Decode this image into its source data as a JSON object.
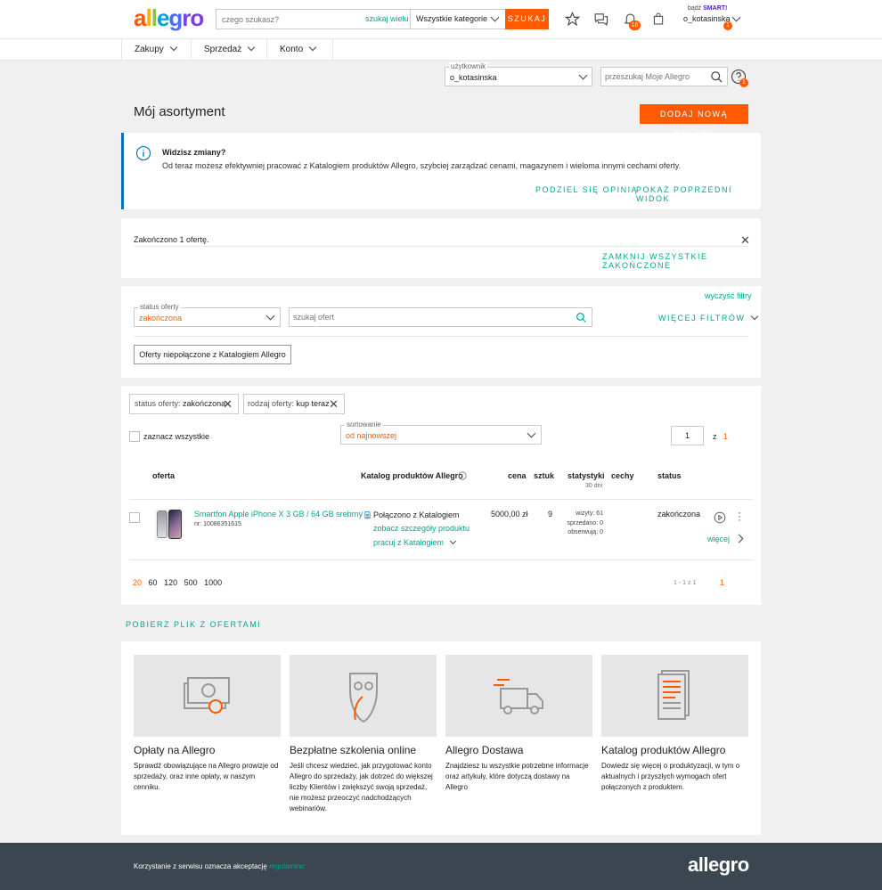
{
  "header": {
    "logo": "allegro",
    "search_placeholder": "czego szukasz?",
    "search_many": "szukaj wielu",
    "category": "Wszystkie kategorie",
    "search_button": "SZUKAJ",
    "notifications_count": "16",
    "smart_prefix": "bądź",
    "smart_label": "SMART!",
    "username": "o_kotasinska",
    "user_badge": "1"
  },
  "nav": {
    "items": [
      "Zakupy",
      "Sprzedaż",
      "Konto"
    ]
  },
  "user_select": {
    "legend": "użytkownik",
    "value": "o_kotasinska"
  },
  "my_search": {
    "placeholder": "przeszukaj Moje Allegro"
  },
  "help_badge": "1",
  "page_title": "Mój asortyment",
  "add_offer_button": "DODAJ NOWĄ OFERTĘ",
  "info_box": {
    "title": "Widzisz zmiany?",
    "text": "Od teraz możesz efektywniej pracować z Katalogiem produktów Allegro, szybciej zarządzać cenami, magazynem i wieloma innymi cechami oferty.",
    "share_link": "PODZIEL SIĘ OPINIĄ",
    "prev_link": "POKAŻ POPRZEDNI WIDOK"
  },
  "ended_box": {
    "text": "Zakończono 1 ofertę.",
    "close_all": "ZAMKNIJ WSZYSTKIE ZAKOŃCZONE"
  },
  "filters": {
    "clear": "wyczyść filtry",
    "status_legend": "status oferty",
    "status_value": "zakończona",
    "search_placeholder": "szukaj ofert",
    "more_filters": "WIĘCEJ FILTRÓW",
    "unlinked_button": "Oferty niepołączone z Katalogiem Allegro"
  },
  "chips": [
    {
      "label": "status oferty:",
      "value": "zakończona"
    },
    {
      "label": "rodzaj oferty:",
      "value": "kup teraz"
    }
  ],
  "select_all": "zaznacz wszystkie",
  "sorting": {
    "legend": "sortowanie",
    "value": "od najnowszej"
  },
  "pagination": {
    "page": "1",
    "of": "z",
    "total": "1"
  },
  "table": {
    "headers": {
      "offer": "oferta",
      "catalog": "Katalog produktów Allegro",
      "price": "cena",
      "qty": "sztuk",
      "stats": "statystyki",
      "stats_sub": "30 dni",
      "features": "cechy",
      "status": "status"
    },
    "rows": [
      {
        "title": "Smartfon Apple iPhone X 3 GB / 64 GB srebrny",
        "id": "nr: 10086351615",
        "catalog_status": "Połączono z Katalogiem",
        "catalog_details": "zobacz szczegóły produktu",
        "catalog_work": "pracuj z Katalogiem",
        "price": "5000,00 zł",
        "qty": "9",
        "visits": "wizyty: 61",
        "sold": "sprzedano: 0",
        "watching": "obserwują: 0",
        "status": "zakończona",
        "more": "więcej"
      }
    ]
  },
  "page_sizes": [
    "20",
    "60",
    "120",
    "500",
    "1000"
  ],
  "page_range": "1 - 1 z 1",
  "page_current": "1",
  "download_link": "POBIERZ PLIK Z OFERTAMI",
  "promo_cards": [
    {
      "title": "Opłaty na Allegro",
      "text": "Sprawdź obowiązujące na Allegro prowizje od sprzedaży, oraz inne opłaty, w naszym cenniku."
    },
    {
      "title": "Bezpłatne szkolenia online",
      "text": "Jeśli chcesz wiedzieć, jak przygotować konto Allegro do sprzedaży, jak dotrzeć do większej liczby Klientów i zwiększyć swoją sprzedaż, nie możesz przeoczyć nadchodzących webinariów."
    },
    {
      "title": "Allegro Dostawa",
      "text": "Znajdziesz tu wszystkie potrzebne informacje oraz artykuły, które dotyczą dostawy na Allegro"
    },
    {
      "title": "Katalog produktów Allegro",
      "text": "Dowiedz się więcej o produktyzacji, w tym o aktualnych i przyszłych wymogach ofert połączonych z produktem."
    }
  ],
  "footer": {
    "text": "Korzystanie z serwisu oznacza akceptację",
    "link": "regulaminu",
    "logo": "allegro"
  },
  "colors": {
    "accent": "#ff5a00",
    "link": "#00a790",
    "info": "#0073b7",
    "footer": "#3b4650"
  }
}
